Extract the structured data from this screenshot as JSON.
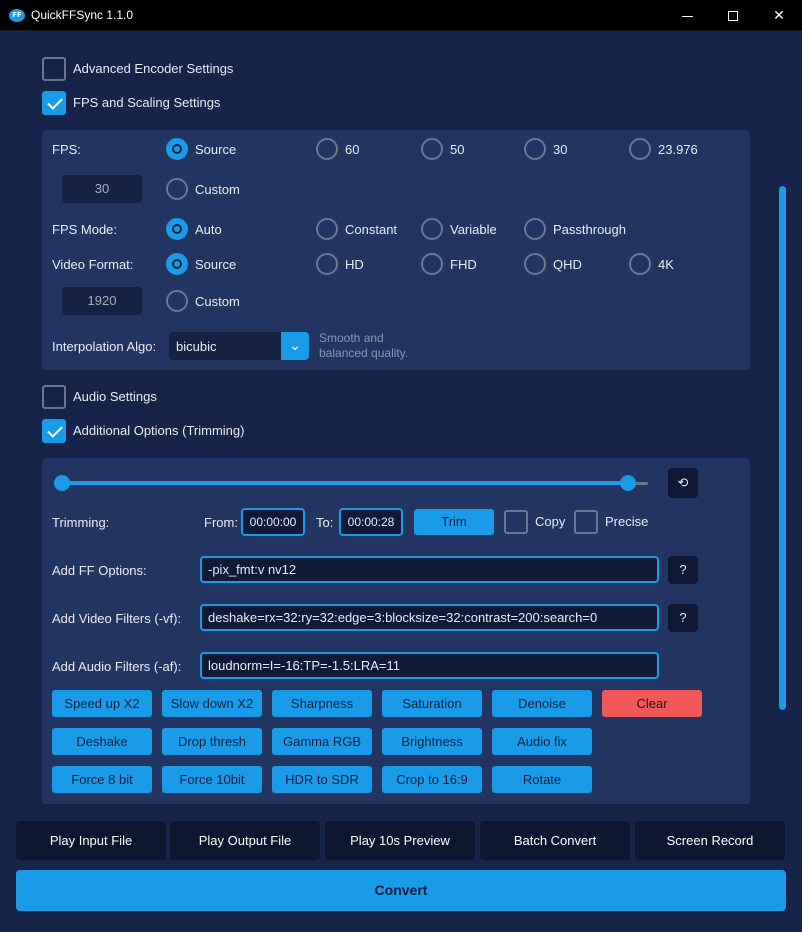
{
  "window": {
    "title": "QuickFFSync 1.1.0",
    "icon_text": "FF",
    "minimize_icon": "minimize-icon",
    "maximize_icon": "maximize-icon",
    "close_icon": "close-icon",
    "close_glyph": "✕"
  },
  "colors": {
    "accent": "#1a9be8",
    "background": "#172449",
    "panel": "#223560",
    "danger": "#f0585a"
  },
  "sections": {
    "advanced_encoder": {
      "label": "Advanced Encoder Settings",
      "checked": false
    },
    "fps_scaling": {
      "label": "FPS and Scaling Settings",
      "checked": true
    },
    "audio": {
      "label": "Audio Settings",
      "checked": false
    },
    "additional": {
      "label": "Additional Options (Trimming)",
      "checked": true
    }
  },
  "fps": {
    "label": "FPS:",
    "options": [
      "Source",
      "60",
      "50",
      "30",
      "23.976"
    ],
    "selected": "Source",
    "custom_value": "30",
    "custom_label": "Custom"
  },
  "fps_mode": {
    "label": "FPS Mode:",
    "options": [
      "Auto",
      "Constant",
      "Variable",
      "Passthrough"
    ],
    "selected": "Auto"
  },
  "video_format": {
    "label": "Video Format:",
    "options": [
      "Source",
      "HD",
      "FHD",
      "QHD",
      "4K"
    ],
    "selected": "Source",
    "custom_value": "1920",
    "custom_label": "Custom"
  },
  "interpolation": {
    "label": "Interpolation Algo:",
    "value": "bicubic",
    "hint_line1": "Smooth and",
    "hint_line2": "balanced quality.",
    "arrow_glyph": "⌄"
  },
  "trimming": {
    "label": "Trimming:",
    "from_label": "From:",
    "from_value": "00:00:00",
    "to_label": "To:",
    "to_value": "00:00:28",
    "trim_button": "Trim",
    "copy_label": "Copy",
    "copy_checked": false,
    "precise_label": "Precise",
    "precise_checked": false,
    "reset_glyph": "⟲",
    "range_start": 0.0,
    "range_end": 1.0
  },
  "ff_options": {
    "label": "Add FF Options:",
    "value": "-pix_fmt:v nv12",
    "help": "?"
  },
  "video_filters": {
    "label": "Add Video Filters (-vf):",
    "value": "deshake=rx=32:ry=32:edge=3:blocksize=32:contrast=200:search=0",
    "help": "?"
  },
  "audio_filters": {
    "label": "Add Audio Filters (-af):",
    "value": "loudnorm=I=-16:TP=-1.5:LRA=11"
  },
  "filter_buttons": [
    [
      "Speed up X2",
      "Slow down X2",
      "Sharpness",
      "Saturation",
      "Denoise",
      "Clear"
    ],
    [
      "Deshake",
      "Drop thresh",
      "Gamma RGB",
      "Brightness",
      "Audio fix"
    ],
    [
      "Force 8 bit",
      "Force 10bit",
      "HDR to SDR",
      "Crop to 16:9",
      "Rotate"
    ]
  ],
  "bottom_buttons": [
    "Play Input File",
    "Play Output File",
    "Play 10s Preview",
    "Batch Convert",
    "Screen Record"
  ],
  "convert_button": "Convert"
}
